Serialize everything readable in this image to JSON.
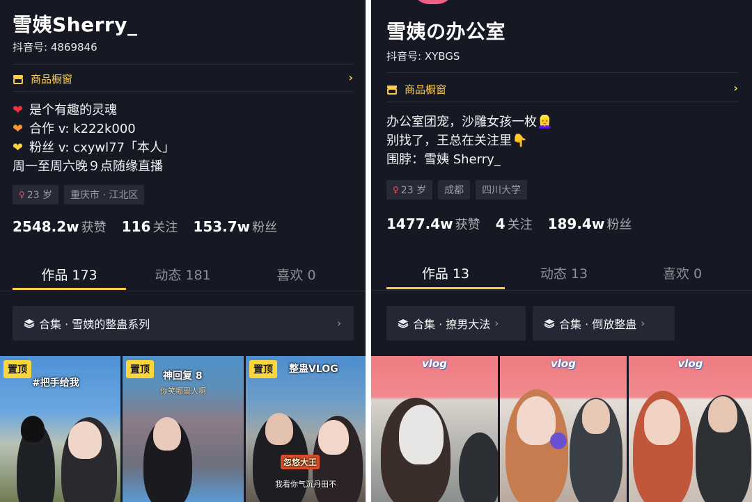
{
  "left_profile": {
    "nickname": "雪姨Sherry_",
    "douyin_id": "抖音号: 4869846",
    "showcase_label": "商品橱窗",
    "bio": [
      {
        "icon": "red-heart",
        "text": "是个有趣的灵魂"
      },
      {
        "icon": "orange-heart",
        "text": "合作 v: k222k000"
      },
      {
        "icon": "yellow-heart",
        "text": "粉丝 v:  cxywl77「本人」"
      },
      {
        "icon": "",
        "text": "周一至周六晚９点随缘直播"
      }
    ],
    "tags": [
      "23 岁",
      "重庆市 · 江北区"
    ],
    "stats": [
      {
        "num": "2548.2w",
        "label": "获赞"
      },
      {
        "num": "116",
        "label": "关注"
      },
      {
        "num": "153.7w",
        "label": "粉丝"
      }
    ],
    "tabs": [
      "作品 173",
      "动态 181",
      "喜欢 0"
    ],
    "collections": [
      "合集 · 雪姨的整蛊系列"
    ],
    "videos": [
      {
        "pin": "置顶",
        "caption": "#把手给我"
      },
      {
        "pin": "置顶",
        "caption": "神回复 8",
        "subtitle": "你笑哪里人啊"
      },
      {
        "pin": "置顶",
        "caption": "整蛊VLOG",
        "bubble": "忽悠大王",
        "subtitle": "我看你气沉丹田不"
      }
    ]
  },
  "right_profile": {
    "nickname": "雪姨の办公室",
    "douyin_id": "抖音号: XYBGS",
    "showcase_label": "商品橱窗",
    "bio": [
      {
        "icon": "",
        "text": "办公室团宠，沙雕女孩一枚👱‍♀️"
      },
      {
        "icon": "",
        "text": "别找了，王总在关注里👇"
      },
      {
        "icon": "",
        "text": "围脖：雪姨 Sherry_"
      }
    ],
    "tags": [
      "23 岁",
      "成都",
      "四川大学"
    ],
    "stats": [
      {
        "num": "1477.4w",
        "label": "获赞"
      },
      {
        "num": "4",
        "label": "关注"
      },
      {
        "num": "189.4w",
        "label": "粉丝"
      }
    ],
    "tabs": [
      "作品 13",
      "动态 13",
      "喜欢 0"
    ],
    "collections": [
      "合集 · 撩男大法",
      "合集 · 倒放整蛊"
    ],
    "videos": [
      {
        "badge": "vlog"
      },
      {
        "badge": "vlog"
      },
      {
        "badge": "vlog"
      }
    ]
  },
  "colors": {
    "background": "#161823",
    "accent_yellow": "#facd4b",
    "tag_bg": "#272a36",
    "collection_bg": "#252734",
    "vlog_pink": "#f07b83"
  }
}
